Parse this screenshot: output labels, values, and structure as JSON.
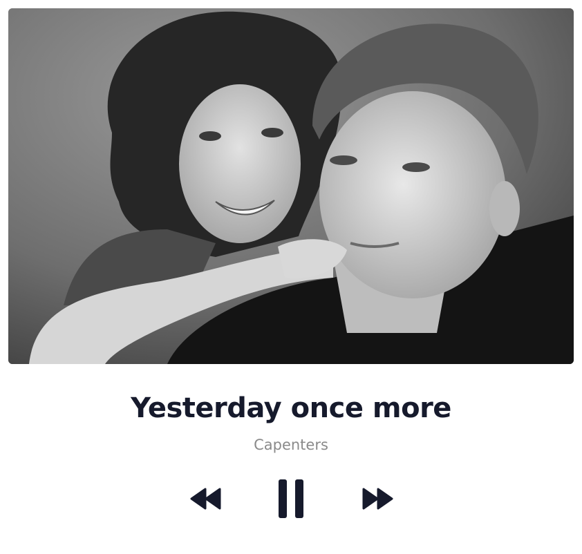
{
  "track": {
    "title": "Yesterday once more",
    "artist": "Capenters"
  },
  "album_art": {
    "description_icon": "album-cover-photo",
    "style": "black-and-white"
  },
  "controls": {
    "rewind_icon": "rewind-icon",
    "pause_icon": "pause-icon",
    "forward_icon": "fast-forward-icon",
    "state": "playing"
  },
  "colors": {
    "title": "#161a2c",
    "artist": "#8a8a8a",
    "controls": "#161a2c",
    "background": "#ffffff"
  }
}
